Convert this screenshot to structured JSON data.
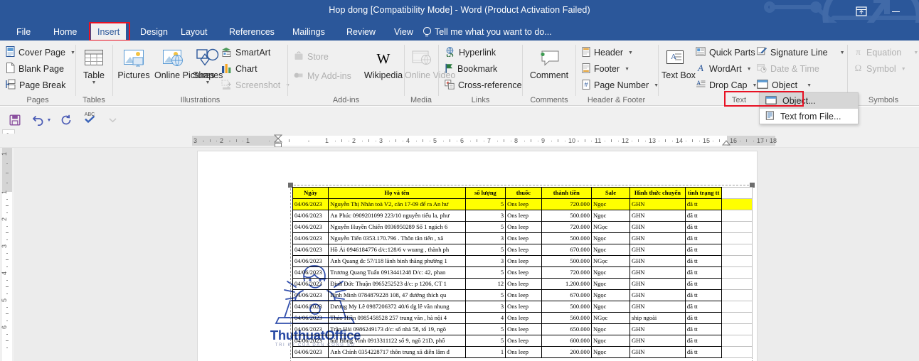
{
  "window": {
    "title": "Hop dong [Compatibility Mode] - Word (Product Activation Failed)",
    "ribbon_display_icon": "ribbon-display-options-icon",
    "minimize_label": "Minimize"
  },
  "tabs": [
    {
      "label": "File",
      "selected": false
    },
    {
      "label": "Home",
      "selected": false
    },
    {
      "label": "Insert",
      "selected": true
    },
    {
      "label": "Design",
      "selected": false
    },
    {
      "label": "Layout",
      "selected": false
    },
    {
      "label": "References",
      "selected": false
    },
    {
      "label": "Mailings",
      "selected": false
    },
    {
      "label": "Review",
      "selected": false
    },
    {
      "label": "View",
      "selected": false
    }
  ],
  "tell_me": {
    "label": "Tell me what you want to do...",
    "icon": "lightbulb-icon"
  },
  "ribbon": {
    "groups": [
      {
        "name": "Pages",
        "label": "Pages",
        "items": [
          {
            "label": "Cover Page",
            "icon": "cover-page-icon",
            "caret": true,
            "disabled": false
          },
          {
            "label": "Blank Page",
            "icon": "blank-page-icon",
            "caret": false,
            "disabled": false
          },
          {
            "label": "Page Break",
            "icon": "page-break-icon",
            "caret": false,
            "disabled": false
          }
        ]
      },
      {
        "name": "Tables",
        "label": "Tables",
        "items": [
          {
            "label": "Table",
            "icon": "table-icon",
            "caret": true,
            "disabled": false
          }
        ]
      },
      {
        "name": "Illustrations",
        "label": "Illustrations",
        "items": [
          {
            "label": "Pictures",
            "icon": "pictures-icon",
            "caret": false,
            "disabled": false
          },
          {
            "label": "Online Pictures",
            "icon": "online-pictures-icon",
            "caret": false,
            "disabled": false
          },
          {
            "label": "Shapes",
            "icon": "shapes-icon",
            "caret": true,
            "disabled": false
          },
          {
            "label": "SmartArt",
            "icon": "smartart-icon",
            "caret": false,
            "disabled": false
          },
          {
            "label": "Chart",
            "icon": "chart-icon",
            "caret": false,
            "disabled": false
          },
          {
            "label": "Screenshot",
            "icon": "screenshot-icon",
            "caret": true,
            "disabled": true
          }
        ]
      },
      {
        "name": "Add-ins",
        "label": "Add-ins",
        "items": [
          {
            "label": "Store",
            "icon": "store-icon",
            "caret": false,
            "disabled": true
          },
          {
            "label": "My Add-ins",
            "icon": "my-addins-icon",
            "caret": true,
            "disabled": true
          },
          {
            "label": "Wikipedia",
            "icon": "wikipedia-icon",
            "caret": false,
            "disabled": false
          }
        ]
      },
      {
        "name": "Media",
        "label": "Media",
        "items": [
          {
            "label": "Online Video",
            "icon": "online-video-icon",
            "caret": false,
            "disabled": true
          }
        ]
      },
      {
        "name": "Links",
        "label": "Links",
        "items": [
          {
            "label": "Hyperlink",
            "icon": "hyperlink-icon",
            "caret": false,
            "disabled": false
          },
          {
            "label": "Bookmark",
            "icon": "bookmark-icon",
            "caret": false,
            "disabled": false
          },
          {
            "label": "Cross-reference",
            "icon": "cross-reference-icon",
            "caret": false,
            "disabled": false
          }
        ]
      },
      {
        "name": "Comments",
        "label": "Comments",
        "items": [
          {
            "label": "Comment",
            "icon": "comment-icon",
            "caret": false,
            "disabled": false
          }
        ]
      },
      {
        "name": "Header & Footer",
        "label": "Header & Footer",
        "items": [
          {
            "label": "Header",
            "icon": "header-icon",
            "caret": true,
            "disabled": false
          },
          {
            "label": "Footer",
            "icon": "footer-icon",
            "caret": true,
            "disabled": false
          },
          {
            "label": "Page Number",
            "icon": "page-number-icon",
            "caret": true,
            "disabled": false
          }
        ]
      },
      {
        "name": "Text",
        "label": "Text",
        "items": [
          {
            "label": "Text Box",
            "icon": "text-box-icon",
            "caret": true,
            "disabled": false
          },
          {
            "label": "Quick Parts",
            "icon": "quick-parts-icon",
            "caret": true,
            "disabled": false
          },
          {
            "label": "WordArt",
            "icon": "wordart-icon",
            "caret": true,
            "disabled": false
          },
          {
            "label": "Drop Cap",
            "icon": "drop-cap-icon",
            "caret": true,
            "disabled": false
          },
          {
            "label": "Signature Line",
            "icon": "signature-line-icon",
            "caret": true,
            "disabled": false
          },
          {
            "label": "Date & Time",
            "icon": "date-time-icon",
            "caret": false,
            "disabled": true
          },
          {
            "label": "Object",
            "icon": "object-icon",
            "caret": true,
            "disabled": false
          }
        ]
      },
      {
        "name": "Symbols",
        "label": "Symbols",
        "items": [
          {
            "label": "Equation",
            "icon": "equation-icon",
            "caret": true,
            "disabled": true
          },
          {
            "label": "Symbol",
            "icon": "symbol-icon",
            "caret": true,
            "disabled": true
          }
        ]
      }
    ]
  },
  "object_menu": {
    "items": [
      {
        "label": "Object...",
        "icon": "object-icon",
        "highlighted": true
      },
      {
        "label": "Text from File...",
        "icon": "text-from-file-icon",
        "highlighted": false
      }
    ]
  },
  "quick_access": [
    {
      "name": "save-button",
      "icon": "save-icon"
    },
    {
      "name": "undo-button",
      "icon": "undo-icon",
      "caret": true
    },
    {
      "name": "redo-button",
      "icon": "redo-icon"
    },
    {
      "name": "spelling-check-button",
      "icon": "spelling-check-icon"
    },
    {
      "name": "customize-qat-button",
      "icon": "chevron-down-icon"
    }
  ],
  "rulers": {
    "horizontal_ticks": [
      "3",
      "2",
      "1",
      "1",
      "2",
      "3",
      "4",
      "5",
      "6",
      "7",
      "8",
      "9",
      "10",
      "11",
      "12",
      "13",
      "14",
      "15",
      "16",
      "17",
      "18"
    ],
    "vertical_ticks": [
      "1",
      "1",
      "2",
      "3",
      "4",
      "5",
      "6"
    ],
    "tab_stop_marker": "L"
  },
  "watermark": {
    "title": "ThuthuatOffice",
    "subtitle": "TRI KỶ CỦA DÂN CÔNG SỞ"
  },
  "embedded_sheet": {
    "selected": true,
    "headers": [
      "Ngày",
      "Họ và tên",
      "số lượng",
      "thuốc",
      "thành tiền",
      "Sale",
      "Hình thức chuyển",
      "tình trạng tt"
    ],
    "rows": [
      {
        "highlighted": true,
        "cells": [
          "04/06/2023",
          "Nguyễn Thị Nhàn toà V2, căn 17-09 để ra An hư",
          "5",
          "Ons leep",
          "720.000",
          "Ngọc",
          "GHN",
          "đã tt"
        ]
      },
      {
        "highlighted": false,
        "cells": [
          "04/06/2023",
          "An Phúc 0909201099 223/10 nguyễn tiểu la, phư",
          "3",
          "Ons leep",
          "500.000",
          "Ngọc",
          "GHN",
          "đã tt"
        ]
      },
      {
        "highlighted": false,
        "cells": [
          "04/06/2023",
          "Nguyễn Huyền Chiến 0936950289 Số 1 ngách 6",
          "5",
          "Ons leep",
          "720.000",
          "NGọc",
          "GHN",
          "đã tt"
        ]
      },
      {
        "highlighted": false,
        "cells": [
          "04/06/2023",
          "Nguyễn Tiến  0353.170.796 . Thôn tân tiến , xã ",
          "3",
          "Ons leep",
          "500.000",
          "Ngọc",
          "GHN",
          "đã tt"
        ]
      },
      {
        "highlighted": false,
        "cells": [
          "04/06/2023",
          "Hồ Ái 0946184776 d/c:128/6 v wuang , thành ph",
          "5",
          "Ons leep",
          "670.000",
          "Ngọc",
          "GHN",
          "đã tt"
        ]
      },
      {
        "highlighted": false,
        "cells": [
          "04/06/2023",
          "Anh Quang đc 57/118 lãnh binh thăng phường 1",
          "3",
          "Ons leep",
          "500.000",
          "NGọc",
          "GHN",
          "đã tt"
        ]
      },
      {
        "highlighted": false,
        "cells": [
          "04/06/2023",
          "Trương Quang Tuấn 0913441248 D/c: 42, phan",
          "5",
          "Ons leep",
          "720.000",
          "Ngọc",
          "GHN",
          "đã tt"
        ]
      },
      {
        "highlighted": false,
        "cells": [
          "04/06/2023",
          "Đinh Đức Thuận 0965252523  d/c: p 1206, CT 1",
          "12",
          "Ons leep",
          "1.200.000",
          "Ngọc",
          "GHN",
          "đã tt"
        ]
      },
      {
        "highlighted": false,
        "cells": [
          "04/06/2023",
          "Bình Minh 0784879228 108,  47 đường thích qu",
          "5",
          "Ons leep",
          "670.000",
          "Ngọc",
          "GHN",
          "đã tt"
        ]
      },
      {
        "highlighted": false,
        "cells": [
          "04/06/2023",
          "Dương My Lê 0987206372 40/6 dg lê văn nhung",
          "3",
          "Ons leep",
          "500.000",
          "Ngọc",
          "GHN",
          "đã tt"
        ]
      },
      {
        "highlighted": false,
        "cells": [
          "04/06/2023",
          "Thảo Hiền 0985458528 257 trung văn , hà nội 4",
          "4",
          "Ons leep",
          "560.000",
          "NGọc",
          "ship ngoài",
          "đã tt"
        ]
      },
      {
        "highlighted": false,
        "cells": [
          "04/06/2023",
          "Trần Hải 0986249173 d/c: số nhà 58, tổ 19, ngõ",
          "5",
          "Ons leep",
          "650.000",
          "Ngọc",
          "GHN",
          "đã tt"
        ]
      },
      {
        "highlighted": false,
        "cells": [
          "04/06/2023",
          "bùi Hồng Vinh 0913311122 số 9, ngõ 21D, phố",
          "5",
          "Ons leep",
          "600.000",
          "Ngọc",
          "GHN",
          "đã tt"
        ]
      },
      {
        "highlighted": false,
        "cells": [
          "04/06/2023",
          "Anh Chính 0354228717 thôn trung xã diễn lâm đ",
          "1",
          "Ons leep",
          "200.000",
          "Ngọc",
          "GHN",
          "đã tt"
        ]
      }
    ]
  },
  "colors": {
    "title_bar": "#2b579a",
    "ribbon_bg": "#f0f0f0",
    "highlight_red": "#e81123",
    "sheet_header": "#ffff00",
    "doc_bg": "#ececec"
  }
}
